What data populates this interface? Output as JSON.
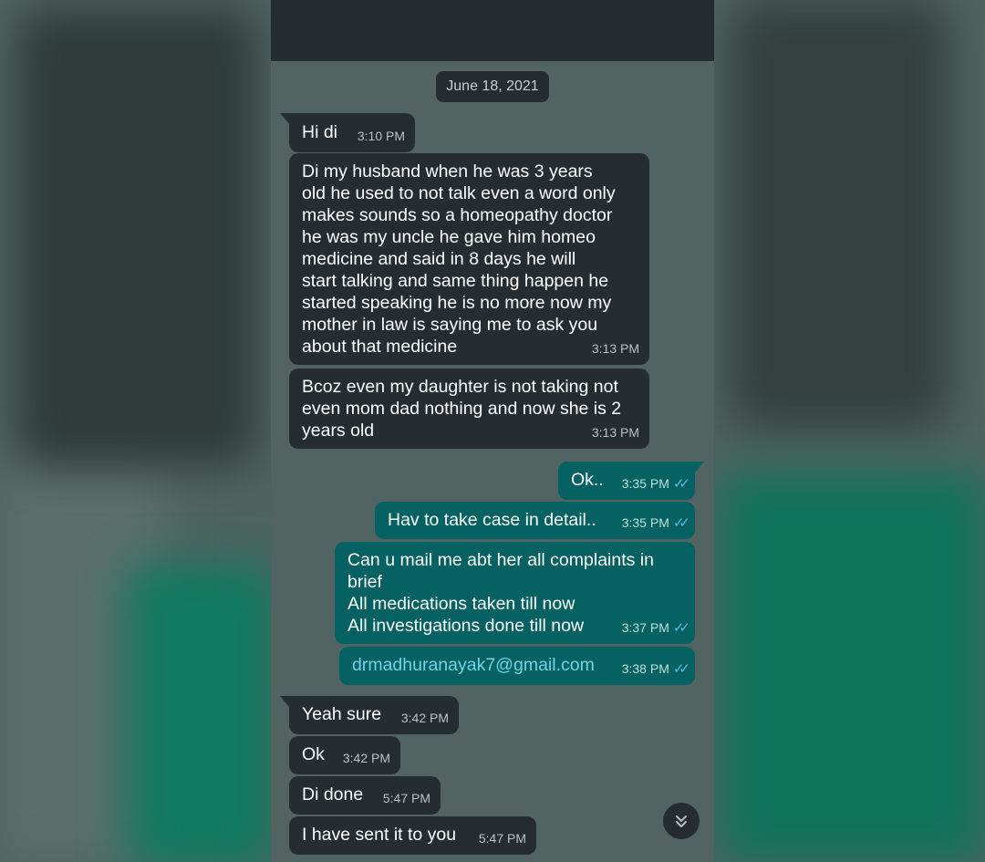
{
  "chat": {
    "date_chip": "June 18, 2021",
    "messages": [
      {
        "dir": "in",
        "text": "Hi di",
        "time": "3:10 PM"
      },
      {
        "dir": "in",
        "text": "Di my husband when he was 3 years\nold he used to not talk even a word only\nmakes sounds so a homeopathy doctor\nhe was my uncle he gave him homeo\nmedicine and said in 8 days he will\nstart talking and same thing happen he\nstarted speaking he is no more now my\nmother in law is saying me to ask you\nabout that medicine",
        "time": "3:13 PM"
      },
      {
        "dir": "in",
        "text": "Bcoz even my daughter is not taking not\neven mom dad nothing and now she is 2\nyears old",
        "time": "3:13 PM"
      },
      {
        "dir": "out",
        "text": "Ok..",
        "time": "3:35 PM"
      },
      {
        "dir": "out",
        "text": "Hav to take case in detail..",
        "time": "3:35 PM"
      },
      {
        "dir": "out",
        "text": "Can u mail me abt her all complaints in\nbrief\nAll medications taken till now\nAll investigations done till now",
        "time": "3:37 PM"
      },
      {
        "dir": "out",
        "text": "drmadhuranayak7@gmail.com",
        "time": "3:38 PM"
      },
      {
        "dir": "in",
        "text": "Yeah sure",
        "time": "3:42 PM"
      },
      {
        "dir": "in",
        "text": "Ok",
        "time": "3:42 PM"
      },
      {
        "dir": "in",
        "text": "Di done",
        "time": "5:47 PM"
      },
      {
        "dir": "in",
        "text": "I have sent it to you",
        "time": "5:47 PM"
      }
    ]
  },
  "icons": {
    "read_receipt": "double-check-icon",
    "scroll_down": "double-chevron-down-icon"
  },
  "colors": {
    "incoming_bubble": "#262d31",
    "outgoing_bubble": "#056162",
    "read_tick": "#53bdeb",
    "link": "#6fd4e6"
  }
}
